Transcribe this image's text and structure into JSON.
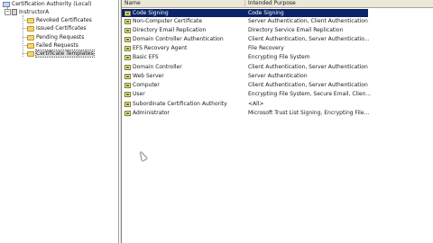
{
  "tree": {
    "root_label": "Certification Authority (Local)",
    "ca_label": "InstructorA",
    "items": [
      {
        "label": "Revoked Certificates"
      },
      {
        "label": "Issued Certificates"
      },
      {
        "label": "Pending Requests"
      },
      {
        "label": "Failed Requests"
      },
      {
        "label": "Certificate Templates"
      }
    ],
    "expander_symbol": "−"
  },
  "list": {
    "columns": [
      "Name",
      "Intended Purpose"
    ],
    "rows": [
      {
        "name": "Code Signing",
        "purpose": "Code Signing"
      },
      {
        "name": "Non-Computer Certificate",
        "purpose": "Server Authentication, Client Authentication"
      },
      {
        "name": "Directory Email Replication",
        "purpose": "Directory Service Email Replication"
      },
      {
        "name": "Domain Controller Authentication",
        "purpose": "Client Authentication, Server Authenticatio..."
      },
      {
        "name": "EFS Recovery Agent",
        "purpose": "File Recovery"
      },
      {
        "name": "Basic EFS",
        "purpose": "Encrypting File System"
      },
      {
        "name": "Domain Controller",
        "purpose": "Client Authentication, Server Authentication"
      },
      {
        "name": "Web Server",
        "purpose": "Server Authentication"
      },
      {
        "name": "Computer",
        "purpose": "Client Authentication, Server Authentication"
      },
      {
        "name": "User",
        "purpose": "Encrypting File System, Secure Email, Clien..."
      },
      {
        "name": "Subordinate Certification Authority",
        "purpose": "<All>"
      },
      {
        "name": "Administrator",
        "purpose": "Microsoft Trust List Signing, Encrypting File..."
      }
    ]
  },
  "colors": {
    "selection": "#0a246a",
    "header_bg": "#ece9d8"
  }
}
